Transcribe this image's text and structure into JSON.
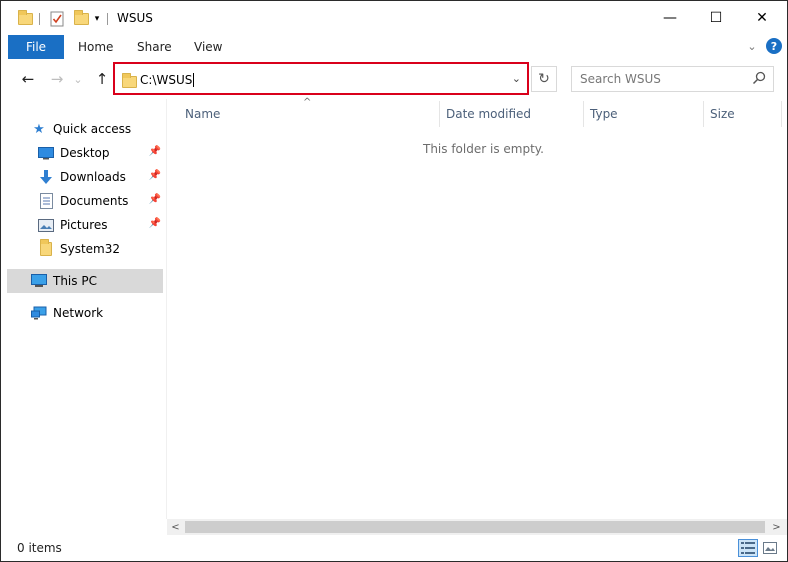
{
  "window": {
    "title": "WSUS",
    "controls": {
      "minimize": "—",
      "maximize": "☐",
      "close": "✕"
    }
  },
  "ribbon": {
    "tabs": [
      {
        "label": "File",
        "active": true,
        "color": "#1a6fc4"
      },
      {
        "label": "Home"
      },
      {
        "label": "Share"
      },
      {
        "label": "View"
      }
    ],
    "expand_icon": "chevron-down-icon",
    "help_icon": "?"
  },
  "navigation": {
    "back_icon": "←",
    "forward_icon": "→",
    "recent_icon": "⌄",
    "up_icon": "↑",
    "address": {
      "value": "C:\\WSUS",
      "highlight_color": "#d9001b"
    },
    "refresh_icon": "↻",
    "search": {
      "placeholder": "Search WSUS"
    }
  },
  "sidebar": {
    "items": [
      {
        "label": "Quick access",
        "icon": "star-icon"
      },
      {
        "label": "Desktop",
        "icon": "desktop-icon",
        "pinned": true
      },
      {
        "label": "Downloads",
        "icon": "download-icon",
        "pinned": true
      },
      {
        "label": "Documents",
        "icon": "document-icon",
        "pinned": true
      },
      {
        "label": "Pictures",
        "icon": "pictures-icon",
        "pinned": true
      },
      {
        "label": "System32",
        "icon": "folder-icon"
      },
      {
        "label": "This PC",
        "icon": "computer-icon",
        "selected": true
      },
      {
        "label": "Network",
        "icon": "network-icon"
      }
    ]
  },
  "content": {
    "columns": [
      "Name",
      "Date modified",
      "Type",
      "Size"
    ],
    "sort_indicator": "^",
    "empty_message": "This folder is empty."
  },
  "statusbar": {
    "item_count": "0 items",
    "views": [
      {
        "name": "details-view-icon",
        "active": true
      },
      {
        "name": "large-icons-view-icon",
        "active": false
      }
    ]
  }
}
